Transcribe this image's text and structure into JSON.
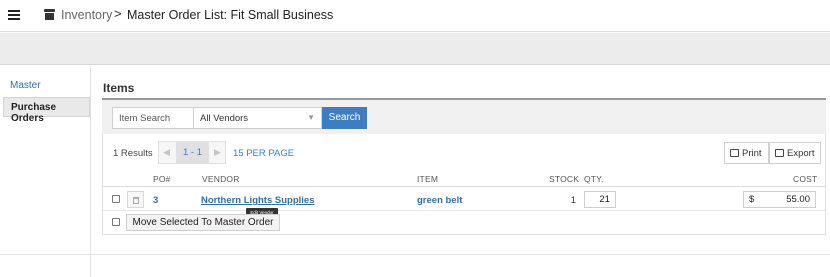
{
  "header": {
    "menu_icon": "hamburger-icon",
    "section_icon": "inventory-box-icon",
    "breadcrumb_link": "Inventory",
    "breadcrumb_sep": ">",
    "page_title": "Master Order List: Fit Small Business"
  },
  "sidebar": {
    "items": [
      {
        "label": "Master",
        "active": false
      },
      {
        "label": "Purchase Orders",
        "active": true
      }
    ]
  },
  "main": {
    "section_title": "Items",
    "search": {
      "placeholder": "Item Search",
      "vendor_selected": "All Vendors",
      "button_label": "Search"
    },
    "results": {
      "count_label": "1 Results",
      "page_label": "1 - 1",
      "per_page_label": "15 PER PAGE"
    },
    "actions": {
      "print_label": "Print",
      "export_label": "Export"
    },
    "table": {
      "columns": {
        "po": "PO#",
        "vendor": "VENDOR",
        "item": "ITEM",
        "stock": "STOCK",
        "qty": "QTY.",
        "cost": "COST"
      },
      "rows": [
        {
          "po": "3",
          "vendor": "Northern Lights Supplies",
          "item": "green belt",
          "stock": "1",
          "qty": "21",
          "cost_currency": "$",
          "cost": "55.00"
        }
      ]
    },
    "tooltip": "Edit Vendor",
    "move_button_label": "Move Selected To Master Order"
  },
  "colors": {
    "accent": "#3d7ec2",
    "link": "#2f6fa8",
    "toolbar_bg": "#ececec"
  }
}
